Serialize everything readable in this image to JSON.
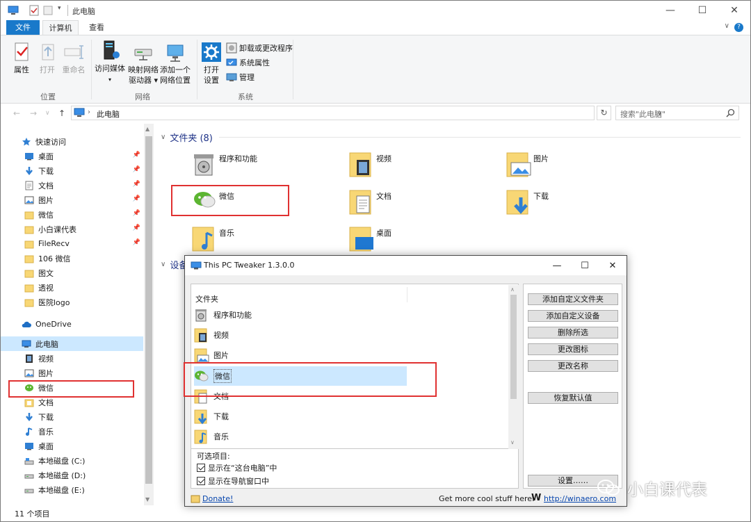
{
  "window": {
    "title": "此电脑",
    "min": "—",
    "max": "☐",
    "close": "✕"
  },
  "ribbon": {
    "tabs": [
      "文件",
      "计算机",
      "查看"
    ],
    "help": "?",
    "collapse": "∨",
    "location_group": {
      "label": "位置",
      "properties": "属性",
      "open": "打开",
      "rename": "重命名"
    },
    "network_group": {
      "label": "网络",
      "access_media": "访问媒体",
      "map_drive_line1": "映射网络",
      "map_drive_line2": "驱动器 ▾",
      "add_location_line1": "添加一个",
      "add_location_line2": "网络位置"
    },
    "system_group": {
      "label": "系统",
      "open_settings_line1": "打开",
      "open_settings_line2": "设置",
      "uninstall": "卸载或更改程序",
      "system_props": "系统属性",
      "manage": "管理"
    }
  },
  "address": {
    "path": "此电脑",
    "search_placeholder": "搜索\"此电脑\""
  },
  "nav": {
    "quick_access": "快速访问",
    "items": [
      {
        "label": "桌面",
        "icon": "desktop-icon",
        "pinned": true
      },
      {
        "label": "下载",
        "icon": "download-icon",
        "pinned": true
      },
      {
        "label": "文档",
        "icon": "document-icon",
        "pinned": true
      },
      {
        "label": "图片",
        "icon": "pictures-icon",
        "pinned": true
      },
      {
        "label": "微信",
        "icon": "folder-icon",
        "pinned": true
      },
      {
        "label": "小白课代表",
        "icon": "folder-icon",
        "pinned": true
      },
      {
        "label": "FileRecv",
        "icon": "folder-icon",
        "pinned": true
      },
      {
        "label": "106 微信",
        "icon": "folder-icon",
        "pinned": false
      },
      {
        "label": "图文",
        "icon": "folder-icon",
        "pinned": false
      },
      {
        "label": "透视",
        "icon": "folder-icon",
        "pinned": false
      },
      {
        "label": "医院logo",
        "icon": "folder-icon",
        "pinned": false
      }
    ],
    "onedrive": "OneDrive",
    "this_pc": "此电脑",
    "pc_items": [
      {
        "label": "视频",
        "icon": "video-icon"
      },
      {
        "label": "图片",
        "icon": "pictures-icon"
      },
      {
        "label": "微信",
        "icon": "wechat-icon"
      },
      {
        "label": "文档",
        "icon": "document-icon"
      },
      {
        "label": "下载",
        "icon": "download-icon"
      },
      {
        "label": "音乐",
        "icon": "music-icon"
      },
      {
        "label": "桌面",
        "icon": "desktop-icon"
      },
      {
        "label": "本地磁盘 (C:)",
        "icon": "drive-icon"
      },
      {
        "label": "本地磁盘 (D:)",
        "icon": "drive-icon"
      },
      {
        "label": "本地磁盘 (E:)",
        "icon": "drive-icon"
      }
    ]
  },
  "content": {
    "folders_header": "文件夹 (8)",
    "devices_header": "设备",
    "folders": [
      {
        "label": "程序和功能",
        "icon": "programs-icon"
      },
      {
        "label": "视频",
        "icon": "video-folder-icon"
      },
      {
        "label": "图片",
        "icon": "pictures-folder-icon"
      },
      {
        "label": "微信",
        "icon": "wechat-icon"
      },
      {
        "label": "文档",
        "icon": "documents-folder-icon"
      },
      {
        "label": "下载",
        "icon": "downloads-folder-icon"
      },
      {
        "label": "音乐",
        "icon": "music-folder-icon"
      },
      {
        "label": "桌面",
        "icon": "desktop-folder-icon"
      }
    ]
  },
  "status": {
    "count": "11 个项目"
  },
  "tweaker": {
    "title": "This PC Tweaker 1.3.0.0",
    "list_header": "文件夹",
    "items": [
      "程序和功能",
      "视频",
      "图片",
      "微信",
      "文档",
      "下载",
      "音乐"
    ],
    "selected_index": 3,
    "options_title": "可选项目:",
    "opt_show_in_pc": "显示在“这台电脑”中",
    "opt_show_in_nav": "显示在导航窗口中",
    "buttons": [
      "添加自定义文件夹",
      "添加自定义设备",
      "删除所选",
      "更改图标",
      "更改名称",
      "恢复默认值"
    ],
    "settings_button": "设置……",
    "donate": "Donate!",
    "get_more": "Get more cool stuff here:",
    "winaero_icon": "W",
    "winaero_link": "http://winaero.com"
  },
  "watermark": {
    "text": "小白课代表"
  },
  "colors": {
    "accent": "#1979ca",
    "selection": "#cce8ff",
    "highlight_box": "#e03131",
    "folder": "#f8d775"
  }
}
